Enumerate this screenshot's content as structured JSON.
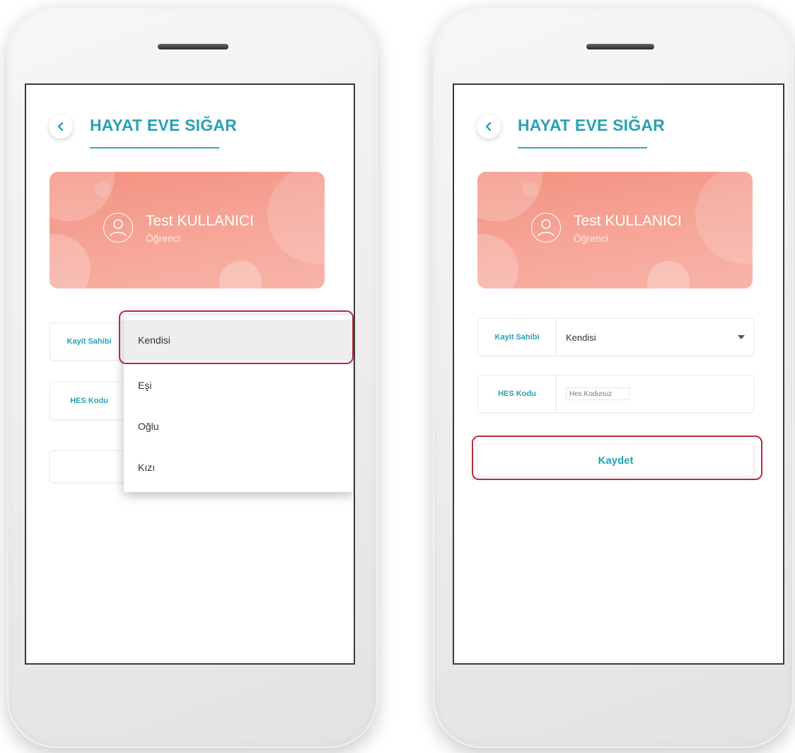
{
  "app": {
    "title": "HAYAT EVE SIĞAR"
  },
  "profile": {
    "name": "Test KULLANICI",
    "role": "Öğrenci"
  },
  "form": {
    "owner_label": "Kayit Sahibi",
    "owner_value": "Kendisi",
    "hes_label": "HES Kodu",
    "hes_placeholder": "Hes Kodunuz",
    "save_label": "Kaydet"
  },
  "dropdown": {
    "options": [
      "Kendisi",
      "Eşi",
      "Oğlu",
      "Kızı"
    ],
    "selected": "Kendisi"
  },
  "icons": {
    "back": "chevron-left-icon",
    "avatar": "user-circle-icon",
    "dropdown": "caret-down-icon"
  },
  "colors": {
    "accent": "#2aa1b3",
    "card": "#f5a091",
    "highlight": "#b32e3c"
  }
}
